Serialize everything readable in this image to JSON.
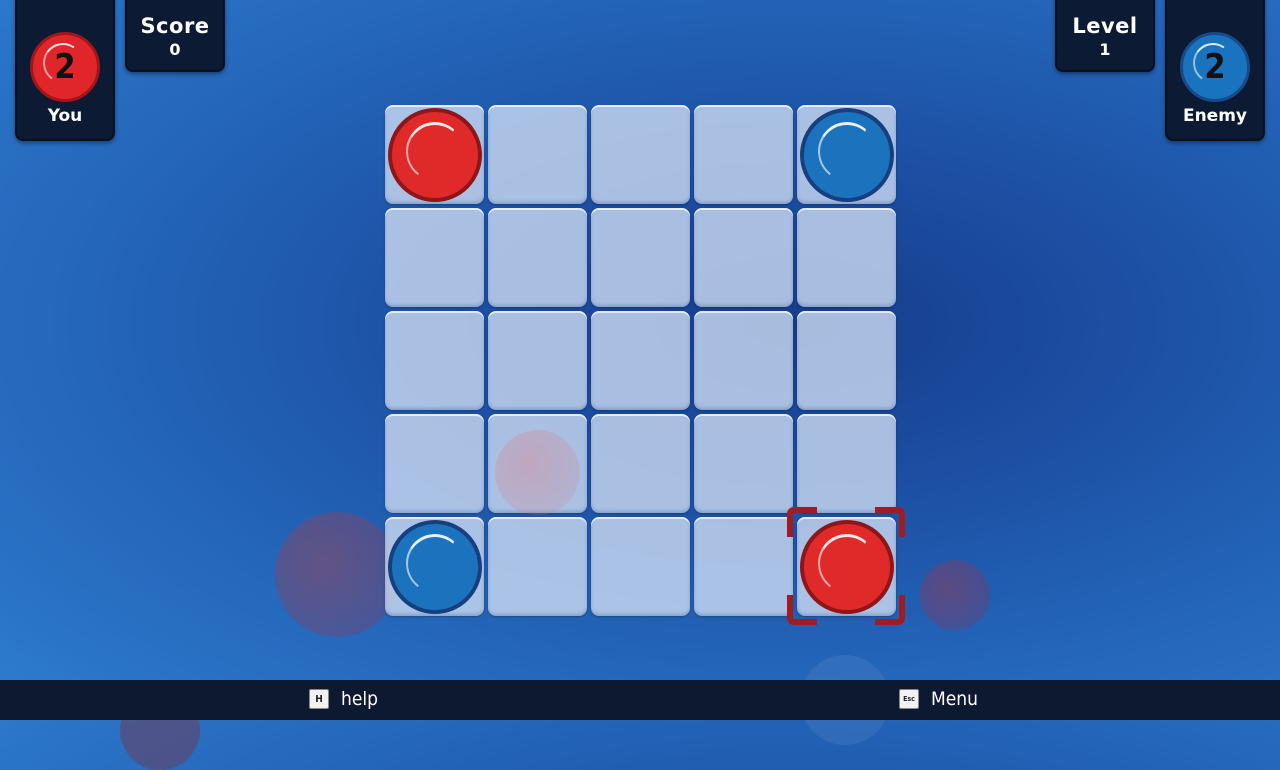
{
  "hud": {
    "player": {
      "count": "2",
      "label": "You",
      "color": "#e0262a"
    },
    "score": {
      "label": "Score",
      "value": "0"
    },
    "level": {
      "label": "Level",
      "value": "1"
    },
    "enemy": {
      "count": "2",
      "label": "Enemy",
      "color": "#1a73bf"
    }
  },
  "board": {
    "rows": 5,
    "cols": 5,
    "cells": [
      [
        "red",
        "",
        "",
        "",
        "blue"
      ],
      [
        "",
        "",
        "",
        "",
        ""
      ],
      [
        "",
        "",
        "",
        "",
        ""
      ],
      [
        "",
        "",
        "",
        "",
        ""
      ],
      [
        "blue",
        "",
        "",
        "",
        "red"
      ]
    ],
    "selected": {
      "row": 4,
      "col": 4
    }
  },
  "footer": {
    "help": {
      "key": "H",
      "label": "help"
    },
    "menu": {
      "key": "Esc",
      "label": "Menu"
    }
  }
}
